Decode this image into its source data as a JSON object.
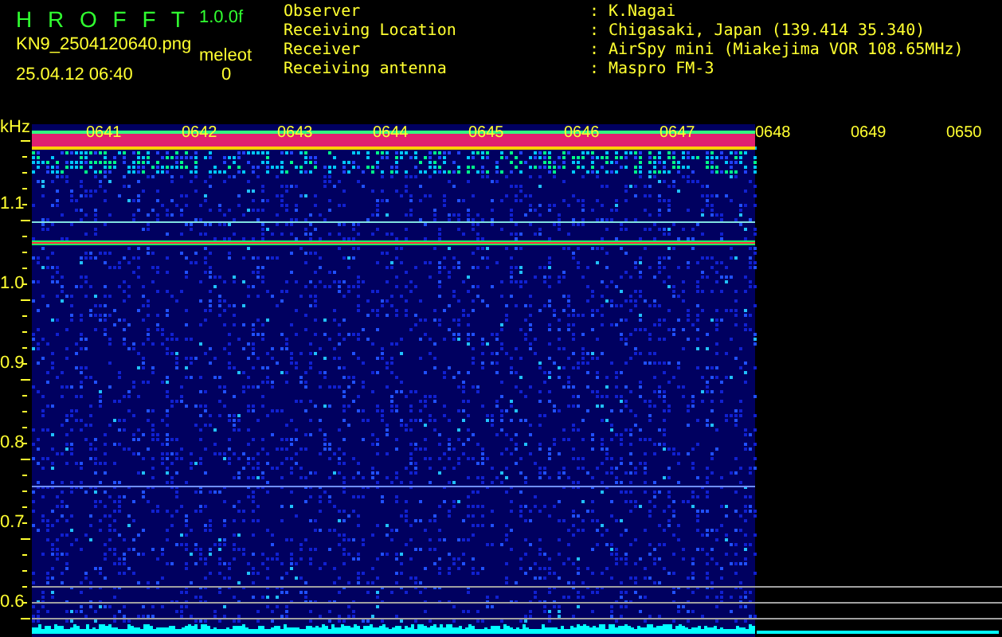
{
  "header": {
    "title": "H R O F F T",
    "version": "1.0.0f",
    "filename": "KN9_2504120640.png",
    "mode_label": "meleot",
    "count": "0",
    "datetime": "25.04.12 06:40"
  },
  "info": [
    {
      "label": "Observer",
      "separator": ":",
      "value": "K.Nagai"
    },
    {
      "label": "Receiving Location",
      "separator": ":",
      "value": "Chigasaki, Japan (139.414 35.340)"
    },
    {
      "label": "Receiver",
      "separator": ":",
      "value": "AirSpy mini (Miakejima VOR 108.65MHz)"
    },
    {
      "label": "Receiving antenna",
      "separator": ":",
      "value": "Maspro FM-3"
    }
  ],
  "plot": {
    "unit": "kHz",
    "y_labels": [
      "1.1",
      "1.0",
      "0.9",
      "0.8",
      "0.7",
      "0.6"
    ],
    "time_labels": [
      "0641",
      "0642",
      "0643",
      "0644",
      "0645",
      "0646",
      "0647",
      "0648",
      "0649",
      "0650"
    ]
  }
}
